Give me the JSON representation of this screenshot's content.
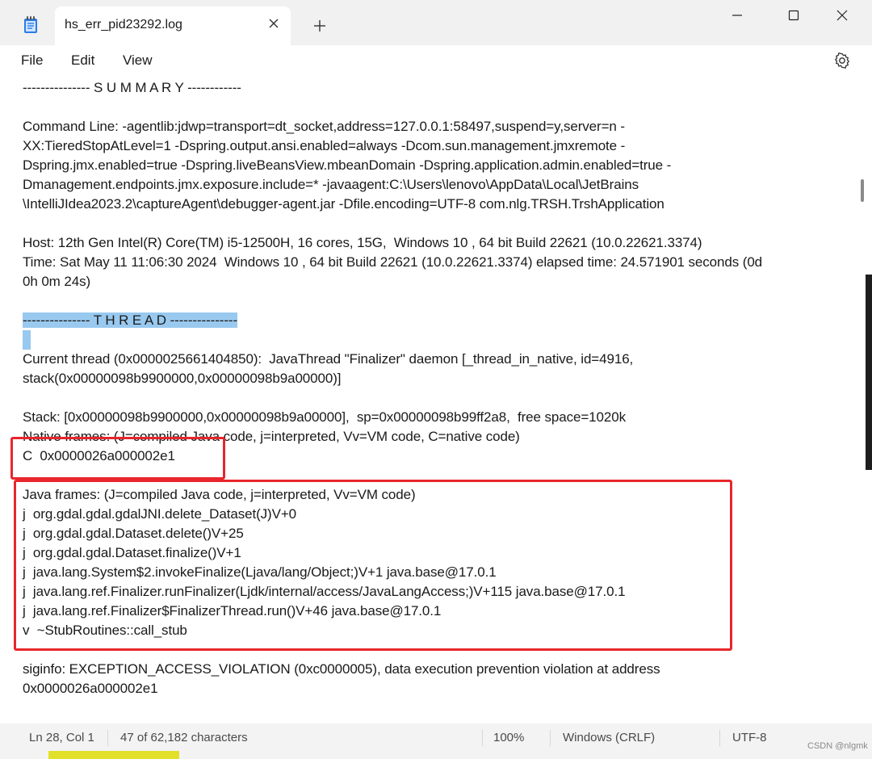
{
  "tab": {
    "title": "hs_err_pid23292.log"
  },
  "menu": {
    "file": "File",
    "edit": "Edit",
    "view": "View"
  },
  "content": {
    "lines": [
      "--------------- S U M M A R Y ------------",
      "",
      "Command Line: -agentlib:jdwp=transport=dt_socket,address=127.0.0.1:58497,suspend=y,server=n -",
      "XX:TieredStopAtLevel=1 -Dspring.output.ansi.enabled=always -Dcom.sun.management.jmxremote -",
      "Dspring.jmx.enabled=true -Dspring.liveBeansView.mbeanDomain -Dspring.application.admin.enabled=true -",
      "Dmanagement.endpoints.jmx.exposure.include=* -javaagent:C:\\Users\\lenovo\\AppData\\Local\\JetBrains",
      "\\IntelliJIdea2023.2\\captureAgent\\debugger-agent.jar -Dfile.encoding=UTF-8 com.nlg.TRSH.TrshApplication",
      "",
      "Host: 12th Gen Intel(R) Core(TM) i5-12500H, 16 cores, 15G,  Windows 10 , 64 bit Build 22621 (10.0.22621.3374)",
      "Time: Sat May 11 11:06:30 2024  Windows 10 , 64 bit Build 22621 (10.0.22621.3374) elapsed time: 24.571901 seconds (0d",
      "0h 0m 24s)",
      "",
      "--------------- T H R E A D ---------------",
      "",
      "Current thread (0x0000025661404850):  JavaThread \"Finalizer\" daemon [_thread_in_native, id=4916,",
      "stack(0x00000098b9900000,0x00000098b9a00000)]",
      "",
      "Stack: [0x00000098b9900000,0x00000098b9a00000],  sp=0x00000098b99ff2a8,  free space=1020k",
      "Native frames: (J=compiled Java code, j=interpreted, Vv=VM code, C=native code)",
      "C  0x0000026a000002e1",
      "",
      "Java frames: (J=compiled Java code, j=interpreted, Vv=VM code)",
      "j  org.gdal.gdal.gdalJNI.delete_Dataset(J)V+0",
      "j  org.gdal.gdal.Dataset.delete()V+25",
      "j  org.gdal.gdal.Dataset.finalize()V+1",
      "j  java.lang.System$2.invokeFinalize(Ljava/lang/Object;)V+1 java.base@17.0.1",
      "j  java.lang.ref.Finalizer.runFinalizer(Ljdk/internal/access/JavaLangAccess;)V+115 java.base@17.0.1",
      "j  java.lang.ref.Finalizer$FinalizerThread.run()V+46 java.base@17.0.1",
      "v  ~StubRoutines::call_stub",
      "",
      "siginfo: EXCEPTION_ACCESS_VIOLATION (0xc0000005), data execution prevention violation at address",
      "0x0000026a000002e1"
    ]
  },
  "status": {
    "position": "Ln 28, Col 1",
    "characters": "47 of 62,182 characters",
    "zoom": "100%",
    "line_ending": "Windows (CRLF)",
    "encoding": "UTF-8"
  },
  "watermark": "CSDN @nlgmk",
  "colors": {
    "annotation_box": "#e8262b",
    "selection": "#99c9ef"
  }
}
